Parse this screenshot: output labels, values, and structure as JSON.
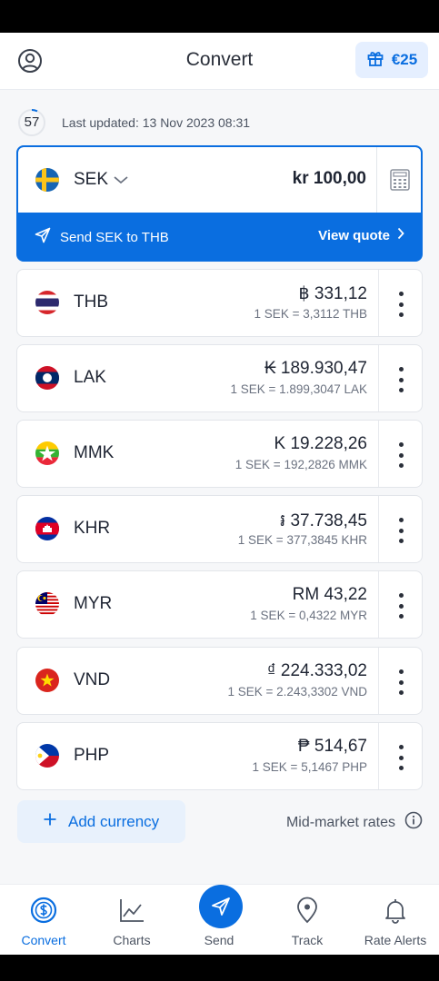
{
  "header": {
    "title": "Convert",
    "reward_label": "€25",
    "icons": {
      "profile": "user-circle-icon",
      "reward": "gift-icon"
    }
  },
  "status": {
    "countdown": "57",
    "last_updated": "Last updated: 13 Nov 2023 08:31"
  },
  "base": {
    "code": "SEK",
    "amount": "kr 100,00",
    "send_label": "Send SEK to THB",
    "view_quote_label": "View quote"
  },
  "currencies": [
    {
      "code": "THB",
      "amount": "฿ 331,12",
      "rate": "1 SEK = 3,3112 THB"
    },
    {
      "code": "LAK",
      "amount": "₭ 189.930,47",
      "rate": "1 SEK = 1.899,3047 LAK"
    },
    {
      "code": "MMK",
      "amount": "K 19.228,26",
      "rate": "1 SEK = 192,2826 MMK"
    },
    {
      "code": "KHR",
      "amount": "៛ 37.738,45",
      "rate": "1 SEK = 377,3845 KHR"
    },
    {
      "code": "MYR",
      "amount": "RM 43,22",
      "rate": "1 SEK = 0,4322 MYR"
    },
    {
      "code": "VND",
      "amount": "₫ 224.333,02",
      "rate": "1 SEK = 2.243,3302 VND"
    },
    {
      "code": "PHP",
      "amount": "₱ 514,67",
      "rate": "1 SEK = 5,1467 PHP"
    }
  ],
  "footer_actions": {
    "add_currency": "Add currency",
    "mid_market": "Mid-market rates"
  },
  "nav": [
    {
      "label": "Convert",
      "icon": "dollar-circle-icon",
      "active": true
    },
    {
      "label": "Charts",
      "icon": "chart-line-icon",
      "active": false
    },
    {
      "label": "Send",
      "icon": "paper-plane-icon",
      "active": false
    },
    {
      "label": "Track",
      "icon": "location-pin-icon",
      "active": false
    },
    {
      "label": "Rate Alerts",
      "icon": "bell-icon",
      "active": false
    }
  ],
  "colors": {
    "accent": "#0a6ee0",
    "background": "#f6f7f9",
    "card": "#ffffff"
  }
}
